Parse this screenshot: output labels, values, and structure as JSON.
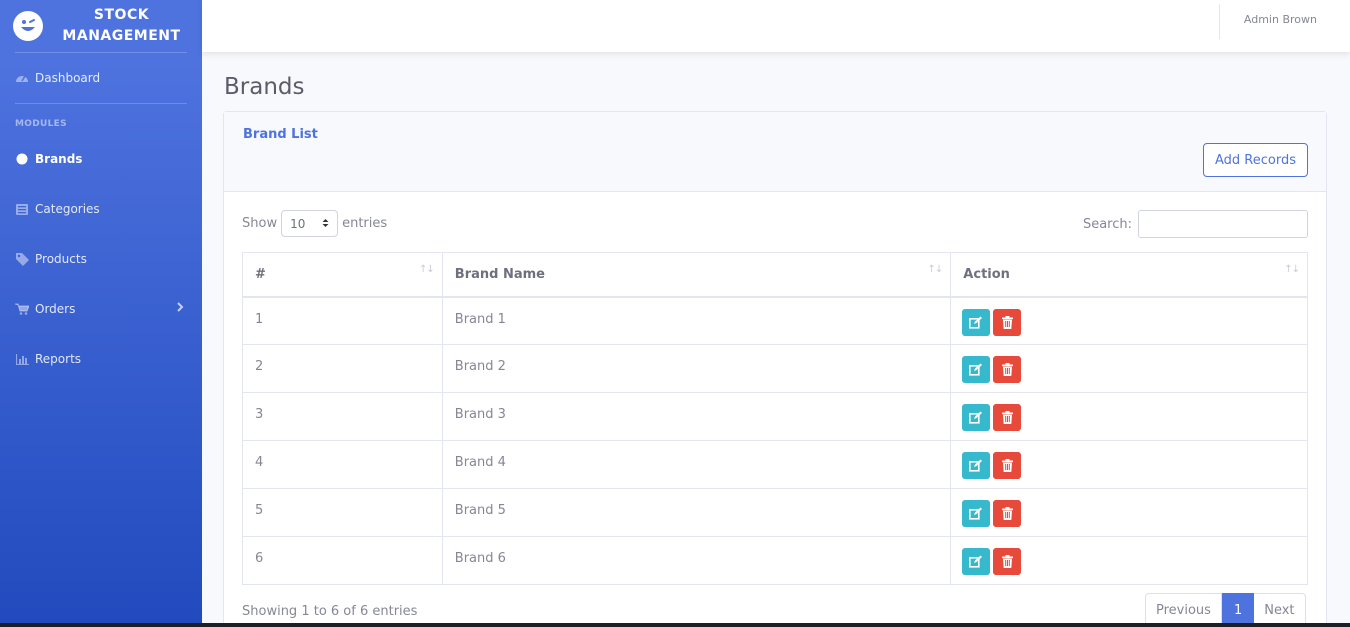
{
  "app": {
    "title": "STOCK MANAGEMENT"
  },
  "sidebar": {
    "dashboard": "Dashboard",
    "heading": "MODULES",
    "items": [
      {
        "label": "Brands",
        "icon": "circle-icon",
        "active": true
      },
      {
        "label": "Categories",
        "icon": "list-icon"
      },
      {
        "label": "Products",
        "icon": "tag-icon"
      },
      {
        "label": "Orders",
        "icon": "cart-icon"
      },
      {
        "label": "Reports",
        "icon": "chart-icon"
      }
    ]
  },
  "topbar": {
    "user": "Admin Brown"
  },
  "page": {
    "title": "Brands"
  },
  "card": {
    "title": "Brand List",
    "add_button": "Add Records"
  },
  "table_controls": {
    "show_label": "Show",
    "entries_value": "10",
    "entries_label": "entries",
    "search_label": "Search:"
  },
  "table": {
    "headers": [
      "#",
      "Brand Name",
      "Action"
    ],
    "rows": [
      {
        "id": "1",
        "name": "Brand 1"
      },
      {
        "id": "2",
        "name": "Brand 2"
      },
      {
        "id": "3",
        "name": "Brand 3"
      },
      {
        "id": "4",
        "name": "Brand 4"
      },
      {
        "id": "5",
        "name": "Brand 5"
      },
      {
        "id": "6",
        "name": "Brand 6"
      }
    ]
  },
  "footer": {
    "info": "Showing 1 to 6 of 6 entries",
    "previous": "Previous",
    "page": "1",
    "next": "Next"
  },
  "colors": {
    "primary": "#4e73df",
    "info": "#36b9cc",
    "danger": "#e74a3b"
  }
}
